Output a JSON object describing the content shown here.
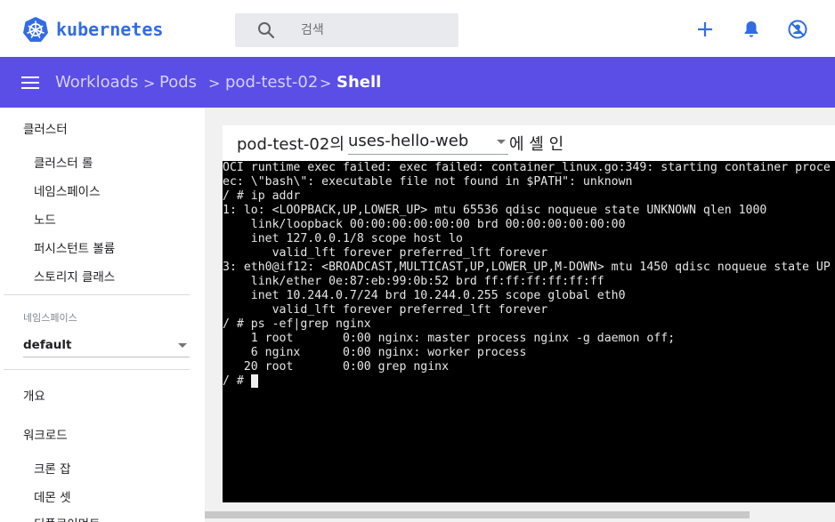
{
  "app": {
    "brand": "kubernetes",
    "brand_color": "#326ce5",
    "bar_color": "#5a4ee6"
  },
  "search": {
    "placeholder": "검색"
  },
  "toolbar": {
    "icons": [
      "plus-icon",
      "bell-icon",
      "no-account-icon"
    ]
  },
  "breadcrumb": {
    "items": [
      "Workloads",
      "Pods",
      "pod-test-02",
      "Shell"
    ],
    "separator": ">"
  },
  "sidebar": {
    "cluster_header": "클러스터",
    "cluster_items": [
      "클러스터 롤",
      "네임스페이스",
      "노드",
      "퍼시스턴트 볼륨",
      "스토리지 클래스"
    ],
    "namespace_label": "네임스페이스",
    "namespace_value": "default",
    "overview": "개요",
    "workloads_header": "워크로드",
    "workload_items": [
      "크론 잡",
      "데몬 셋",
      "디플로이먼트"
    ]
  },
  "shell": {
    "title_prefix": "pod-test-02의",
    "container": "uses-hello-web",
    "title_suffix": "에 셸 인",
    "lines": [
      "OCI runtime exec failed: exec failed: container_linux.go:349: starting container proce",
      "ec: \\\"bash\\\": executable file not found in $PATH\": unknown",
      "/ # ip addr",
      "1: lo: <LOOPBACK,UP,LOWER_UP> mtu 65536 qdisc noqueue state UNKNOWN qlen 1000",
      "    link/loopback 00:00:00:00:00:00 brd 00:00:00:00:00:00",
      "    inet 127.0.0.1/8 scope host lo",
      "       valid_lft forever preferred_lft forever",
      "3: eth0@if12: <BROADCAST,MULTICAST,UP,LOWER_UP,M-DOWN> mtu 1450 qdisc noqueue state UP",
      "    link/ether 0e:87:eb:99:0b:52 brd ff:ff:ff:ff:ff:ff",
      "    inet 10.244.0.7/24 brd 10.244.0.255 scope global eth0",
      "       valid_lft forever preferred_lft forever",
      "/ # ps -ef|grep nginx",
      "    1 root       0:00 nginx: master process nginx -g daemon off;",
      "    6 nginx      0:00 nginx: worker process",
      "   20 root       0:00 grep nginx",
      "/ # "
    ]
  }
}
